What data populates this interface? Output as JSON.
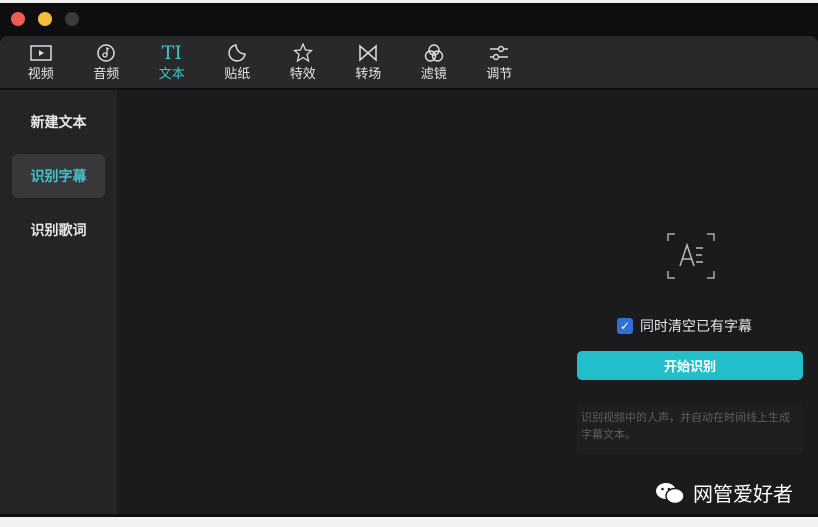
{
  "window": {
    "controls": [
      {
        "name": "close",
        "color": "#ee5a55"
      },
      {
        "name": "minimize",
        "color": "#f5bd3a"
      },
      {
        "name": "zoom",
        "color": "#3a3a3c"
      }
    ]
  },
  "toolbar": {
    "items": [
      {
        "label": "视频",
        "icon": "video-icon"
      },
      {
        "label": "音频",
        "icon": "music-icon"
      },
      {
        "label": "文本",
        "icon": "text-icon",
        "active": true
      },
      {
        "label": "贴纸",
        "icon": "sticker-icon"
      },
      {
        "label": "特效",
        "icon": "effects-icon"
      },
      {
        "label": "转场",
        "icon": "transition-icon"
      },
      {
        "label": "滤镜",
        "icon": "filter-icon"
      },
      {
        "label": "调节",
        "icon": "adjust-icon"
      }
    ]
  },
  "text_icon_glyph": "TI",
  "sidebar": {
    "items": [
      {
        "label": "新建文本"
      },
      {
        "label": "识别字幕",
        "active": true
      },
      {
        "label": "识别歌词"
      }
    ]
  },
  "main": {
    "checkbox_label": "同时清空已有字幕",
    "checkbox_checked": true,
    "start_button": "开始识别",
    "description": "识别视频中的人声，并自动在时间线上生成字幕文本。"
  },
  "watermark": "网管爱好者",
  "colors": {
    "accent": "#3fc3cc",
    "button": "#22bfcb"
  }
}
